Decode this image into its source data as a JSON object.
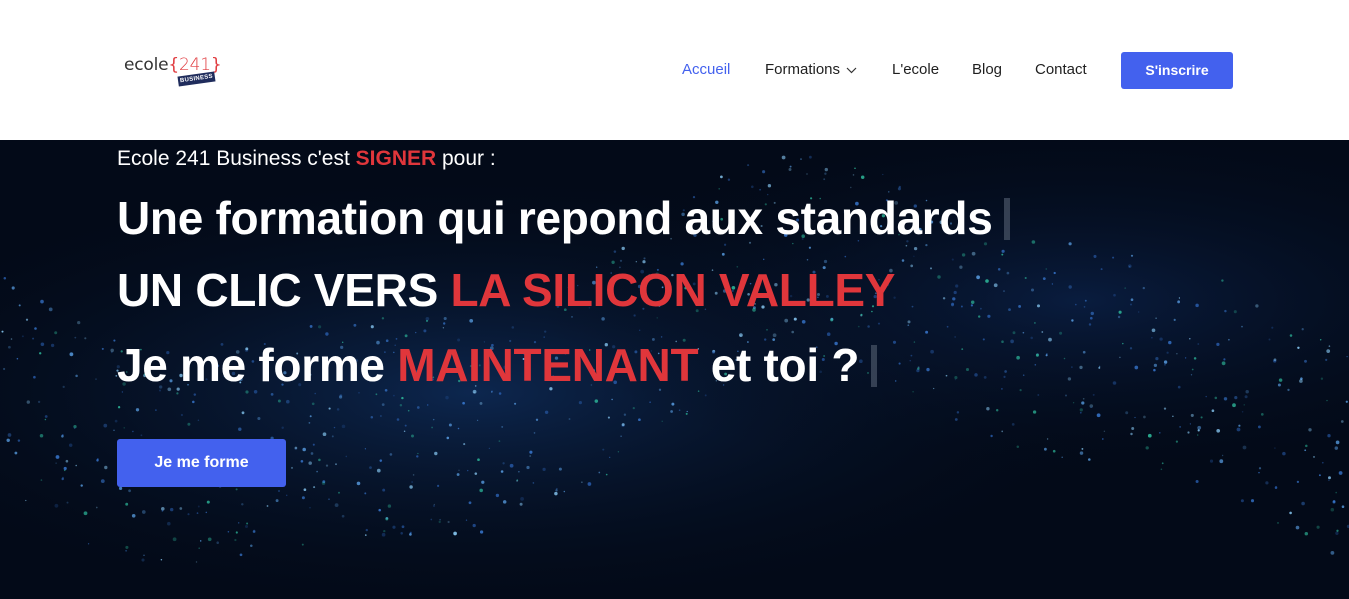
{
  "logo": {
    "word": "ecole",
    "brace_open": "{",
    "number": "241",
    "brace_close": "}",
    "badge": "BUSINESS"
  },
  "nav": {
    "items": [
      {
        "label": "Accueil",
        "active": true
      },
      {
        "label": "Formations",
        "has_dropdown": true,
        "icon": "chevron-down-icon"
      },
      {
        "label": "L'ecole"
      },
      {
        "label": "Blog"
      },
      {
        "label": "Contact"
      }
    ],
    "signup_label": "S'inscrire"
  },
  "hero": {
    "intro_before": "Ecole 241 Business c'est ",
    "intro_highlight": "SIGNER",
    "intro_after": " pour :",
    "line1": "Une formation qui repond aux standards",
    "line2_before": "UN CLIC VERS ",
    "line2_highlight": "LA SILICON VALLEY",
    "line3_before": "Je me forme ",
    "line3_highlight": "MAINTENANT",
    "line3_after": " et toi ?",
    "cta_label": "Je me forme"
  },
  "colors": {
    "accent": "#4361ee",
    "highlight": "#e0363b",
    "hero_bg": "#030a18"
  }
}
